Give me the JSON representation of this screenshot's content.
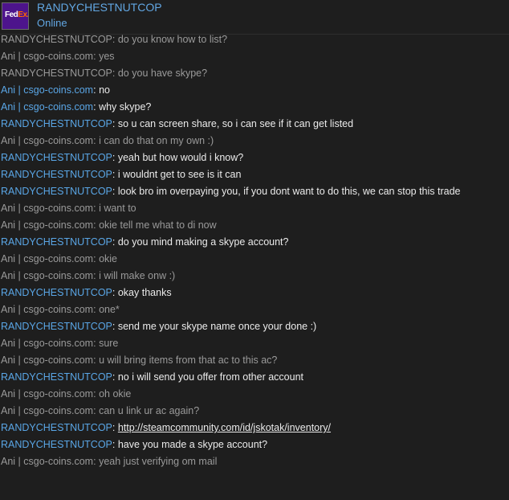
{
  "header": {
    "contact_name": "RANDYCHESTNUTCOP",
    "status": "Online",
    "avatar_logo": {
      "fed": "Fed",
      "ex": "Ex."
    },
    "avatar_color": "#4d148c"
  },
  "colors": {
    "background": "#1e1e1e",
    "self_name": "#9a9a9a",
    "contact_name": "#5aa6e6",
    "contact_message": "#ebebeb"
  },
  "messages": [
    {
      "sender": "RANDYCHESTNUTCOP",
      "from": "me",
      "text": "do you know how to list?"
    },
    {
      "sender": "Ani | csgo-coins.com",
      "from": "me",
      "text": "yes"
    },
    {
      "sender": "RANDYCHESTNUTCOP",
      "from": "me",
      "text": "do you have skype?"
    },
    {
      "sender": "Ani | csgo-coins.com",
      "from": "them",
      "text": "no"
    },
    {
      "sender": "Ani | csgo-coins.com",
      "from": "them",
      "text": "why skype?"
    },
    {
      "sender": "RANDYCHESTNUTCOP",
      "from": "them",
      "text": "so u can screen share, so i can see if it can get listed"
    },
    {
      "sender": "Ani | csgo-coins.com",
      "from": "me",
      "text": "i can do that on my own :)"
    },
    {
      "sender": "RANDYCHESTNUTCOP",
      "from": "them",
      "text": "yeah but how would i know?"
    },
    {
      "sender": "RANDYCHESTNUTCOP",
      "from": "them",
      "text": "i wouldnt get to see is it can"
    },
    {
      "sender": "RANDYCHESTNUTCOP",
      "from": "them",
      "text": "look bro im overpaying you, if you dont want to do this, we can stop this trade"
    },
    {
      "sender": "Ani | csgo-coins.com",
      "from": "me",
      "text": "i want to"
    },
    {
      "sender": "Ani | csgo-coins.com",
      "from": "me",
      "text": "okie tell me what to di now"
    },
    {
      "sender": "RANDYCHESTNUTCOP",
      "from": "them",
      "text": "do you mind making a skype account?"
    },
    {
      "sender": "Ani | csgo-coins.com",
      "from": "me",
      "text": "okie"
    },
    {
      "sender": "Ani | csgo-coins.com",
      "from": "me",
      "text": "i will make onw :)"
    },
    {
      "sender": "RANDYCHESTNUTCOP",
      "from": "them",
      "text": "okay thanks"
    },
    {
      "sender": "Ani | csgo-coins.com",
      "from": "me",
      "text": "one*"
    },
    {
      "sender": "RANDYCHESTNUTCOP",
      "from": "them",
      "text": "send me your skype name once your done :)"
    },
    {
      "sender": "Ani | csgo-coins.com",
      "from": "me",
      "text": "sure"
    },
    {
      "sender": "Ani | csgo-coins.com",
      "from": "me",
      "text": "u will bring items from that ac to this ac?"
    },
    {
      "sender": "RANDYCHESTNUTCOP",
      "from": "them",
      "text": "no i will send you offer from other account"
    },
    {
      "sender": "Ani | csgo-coins.com",
      "from": "me",
      "text": "oh okie"
    },
    {
      "sender": "Ani | csgo-coins.com",
      "from": "me",
      "text": "can u link ur ac again?"
    },
    {
      "sender": "RANDYCHESTNUTCOP",
      "from": "them",
      "text": "http://steamcommunity.com/id/jskotak/inventory/",
      "link": true
    },
    {
      "sender": "RANDYCHESTNUTCOP",
      "from": "them",
      "text": "have you made a skype account?"
    },
    {
      "sender": "Ani | csgo-coins.com",
      "from": "me",
      "text": "yeah just verifying om mail"
    }
  ]
}
